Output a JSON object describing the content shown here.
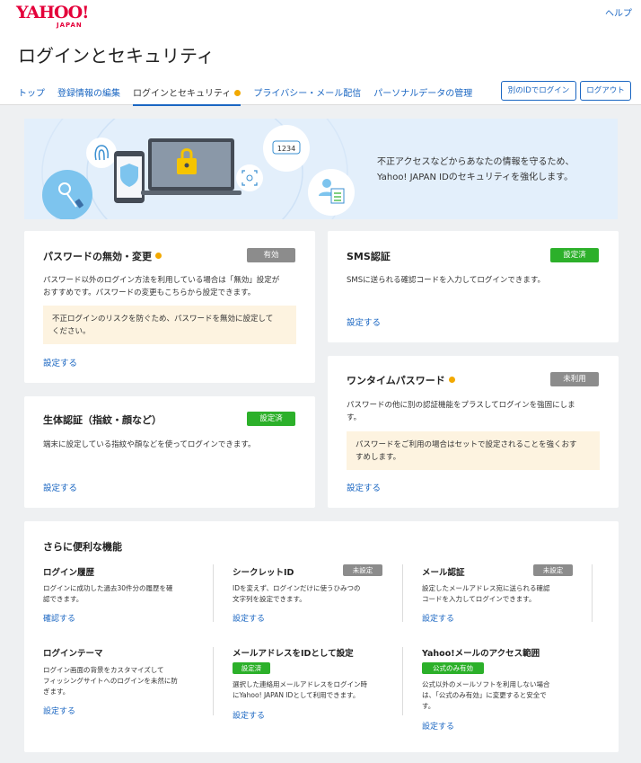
{
  "header": {
    "logo_main": "YAHOO!",
    "logo_sub": "JAPAN",
    "help": "ヘルプ",
    "title": "ログインとセキュリティ",
    "tabs": [
      "トップ",
      "登録情報の編集",
      "ログインとセキュリティ",
      "プライバシー・メール配信",
      "パーソナルデータの管理"
    ],
    "btn_other_id": "別のIDでログイン",
    "btn_logout": "ログアウト"
  },
  "hero": {
    "line1": "不正アクセスなどからあなたの情報を守るため、",
    "line2": "Yahoo! JAPAN IDのセキュリティを強化します。",
    "pin_text": "1234"
  },
  "password_card": {
    "title": "パスワードの無効・変更",
    "badge": "有効",
    "desc1": "パスワード以外のログイン方法を利用している場合は「無効」設定が",
    "desc2": "おすすめです。パスワードの変更もこちらから設定できます。",
    "note1": "不正ログインのリスクを防ぐため、パスワードを無効に設定して",
    "note2": "ください。",
    "link": "設定する"
  },
  "sms_card": {
    "title": "SMS認証",
    "badge": "設定済",
    "desc": "SMSに送られる確認コードを入力してログインできます。",
    "link": "設定する"
  },
  "bio_card": {
    "title": "生体認証（指紋・顔など）",
    "badge": "設定済",
    "desc": "端末に設定している指紋や顔などを使ってログインできます。",
    "link": "設定する"
  },
  "otp_card": {
    "title": "ワンタイムパスワード",
    "badge": "未利用",
    "desc1": "パスワードの他に別の認証機能をプラスしてログインを強固にしま",
    "desc2": "す。",
    "note1": "パスワードをご利用の場合はセットで設定されることを強くおす",
    "note2": "すめします。",
    "link": "設定する"
  },
  "more": {
    "title": "さらに便利な機能",
    "features": [
      {
        "title": "ログイン履歴",
        "badge": "",
        "desc1": "ログインに成功した過去30件分の履歴を確",
        "desc2": "認できます。",
        "desc3": "",
        "link": "確認する"
      },
      {
        "title": "シークレットID",
        "badge": "未設定",
        "desc1": "IDを変えず、ログインだけに使うひみつの",
        "desc2": "文字列を設定できます。",
        "desc3": "",
        "link": "設定する"
      },
      {
        "title": "メール認証",
        "badge": "未設定",
        "desc1": "設定したメールアドレス宛に送られる確認",
        "desc2": "コードを入力してログインできます。",
        "desc3": "",
        "link": "設定する"
      },
      {
        "title": "ログインテーマ",
        "badge": "",
        "desc1": "ログイン画面の背景をカスタマイズして",
        "desc2": "フィッシングサイトへのログインを未然に防",
        "desc3": "ぎます。",
        "link": "設定する"
      },
      {
        "title": "メールアドレスをIDとして設定",
        "badge": "設定済",
        "desc1": "選択した連絡用メールアドレスをログイン時",
        "desc2": "にYahoo! JAPAN IDとして利用できます。",
        "desc3": "",
        "link": "設定する"
      },
      {
        "title": "Yahoo!メールのアクセス範囲",
        "badge": "公式のみ有効",
        "desc1": "公式以外のメールソフトを利用しない場合",
        "desc2": "は、「公式のみ有効」に変更すると安全で",
        "desc3": "す。",
        "link": "設定する"
      }
    ]
  },
  "colors": {
    "accent": "#1a66c2",
    "brand": "#e4003a",
    "status_ok": "#2cb02a",
    "status_off": "#8c8c8c",
    "warning_dot": "#f2a900"
  }
}
